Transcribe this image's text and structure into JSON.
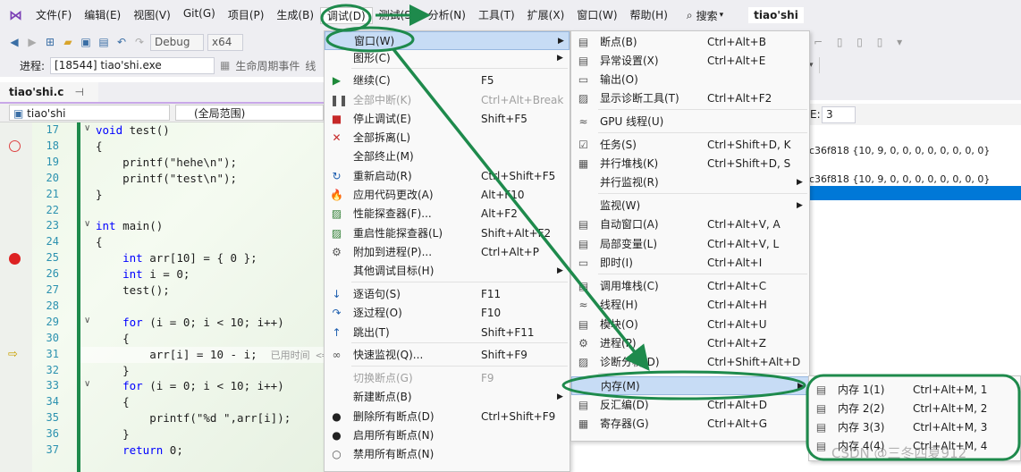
{
  "menubar": {
    "items": [
      "文件(F)",
      "编辑(E)",
      "视图(V)",
      "Git(G)",
      "项目(P)",
      "生成(B)",
      "调试(D)",
      "测试(S)",
      "分析(N)",
      "工具(T)",
      "扩展(X)",
      "窗口(W)",
      "帮助(H)"
    ],
    "search": "搜索",
    "solution": "tiao'shi"
  },
  "toolbar": {
    "config": "Debug",
    "platform": "x64"
  },
  "toolbar2": {
    "process_label": "进程:",
    "process_value": "[18544] tiao'shi.exe",
    "lifecycle": "生命周期事件",
    "thread_prefix": "线"
  },
  "editor": {
    "tab": "tiao'shi.c",
    "tab_pin": "⊣",
    "tab_close": "✕",
    "nav_left": "tiao'shi",
    "nav_right": "(全局范围)",
    "lines": [
      "17",
      "18",
      "19",
      "20",
      "21",
      "22",
      "23",
      "24",
      "25",
      "26",
      "27",
      "28",
      "29",
      "30",
      "31",
      "32",
      "33",
      "34",
      "35",
      "36",
      "37"
    ],
    "code": [
      "void test()",
      "{",
      "    printf(\"hehe\\n\");",
      "    printf(\"test\\n\");",
      "}",
      "",
      "int main()",
      "{",
      "    int arr[10] = { 0 };",
      "    int i = 0;",
      "    test();",
      "",
      "    for (i = 0; i < 10; i++)",
      "    {",
      "        arr[i] = 10 - i;  已用时间 <=",
      "    }",
      "    for (i = 0; i < 10; i++)",
      "    {",
      "        printf(\"%d \",arr[i]);",
      "    }",
      "    return 0;"
    ]
  },
  "debug_menu": {
    "items": [
      {
        "label": "窗口(W)",
        "shortcut": "",
        "icon": "",
        "dis": false,
        "arrow": true
      },
      {
        "label": "图形(C)",
        "shortcut": "",
        "icon": "",
        "dis": false,
        "arrow": true
      },
      {
        "label": "继续(C)",
        "shortcut": "F5",
        "icon": "play-icon",
        "dis": false
      },
      {
        "label": "全部中断(K)",
        "shortcut": "Ctrl+Alt+Break",
        "icon": "pause-icon",
        "dis": true
      },
      {
        "label": "停止调试(E)",
        "shortcut": "Shift+F5",
        "icon": "stop-icon",
        "dis": false
      },
      {
        "label": "全部拆离(L)",
        "shortcut": "",
        "icon": "detach-icon",
        "dis": false
      },
      {
        "label": "全部终止(M)",
        "shortcut": "",
        "icon": "",
        "dis": false
      },
      {
        "label": "重新启动(R)",
        "shortcut": "Ctrl+Shift+F5",
        "icon": "restart-icon",
        "dis": false
      },
      {
        "label": "应用代码更改(A)",
        "shortcut": "Alt+F10",
        "icon": "hot-reload-icon",
        "dis": false
      },
      {
        "label": "性能探查器(F)...",
        "shortcut": "Alt+F2",
        "icon": "profiler-icon",
        "dis": false
      },
      {
        "label": "重启性能探查器(L)",
        "shortcut": "Shift+Alt+F2",
        "icon": "profiler-restart-icon",
        "dis": false
      },
      {
        "label": "附加到进程(P)...",
        "shortcut": "Ctrl+Alt+P",
        "icon": "attach-icon",
        "dis": false
      },
      {
        "label": "其他调试目标(H)",
        "shortcut": "",
        "icon": "",
        "dis": false,
        "arrow": true
      },
      {
        "label": "逐语句(S)",
        "shortcut": "F11",
        "icon": "step-into-icon",
        "dis": false
      },
      {
        "label": "逐过程(O)",
        "shortcut": "F10",
        "icon": "step-over-icon",
        "dis": false
      },
      {
        "label": "跳出(T)",
        "shortcut": "Shift+F11",
        "icon": "step-out-icon",
        "dis": false
      },
      {
        "label": "快速监视(Q)...",
        "shortcut": "Shift+F9",
        "icon": "glasses-icon",
        "dis": false
      },
      {
        "label": "切换断点(G)",
        "shortcut": "F9",
        "icon": "",
        "dis": true
      },
      {
        "label": "新建断点(B)",
        "shortcut": "",
        "icon": "",
        "dis": false,
        "arrow": true
      },
      {
        "label": "删除所有断点(D)",
        "shortcut": "Ctrl+Shift+F9",
        "icon": "delete-breakpoints-icon",
        "dis": false
      },
      {
        "label": "启用所有断点(N)",
        "shortcut": "",
        "icon": "enable-breakpoints-icon",
        "dis": false
      },
      {
        "label": "禁用所有断点(N)",
        "shortcut": "",
        "icon": "disable-breakpoints-icon",
        "dis": false
      }
    ]
  },
  "window_menu": {
    "items": [
      {
        "label": "断点(B)",
        "shortcut": "Ctrl+Alt+B",
        "icon": "breakpoints-window-icon"
      },
      {
        "label": "异常设置(X)",
        "shortcut": "Ctrl+Alt+E",
        "icon": "exception-icon"
      },
      {
        "label": "输出(O)",
        "shortcut": "",
        "icon": "output-icon"
      },
      {
        "label": "显示诊断工具(T)",
        "shortcut": "Ctrl+Alt+F2",
        "icon": "diagnostics-icon"
      },
      {
        "label": "GPU 线程(U)",
        "shortcut": "",
        "icon": "gpu-threads-icon"
      },
      {
        "label": "任务(S)",
        "shortcut": "Ctrl+Shift+D, K",
        "icon": "tasks-icon"
      },
      {
        "label": "并行堆栈(K)",
        "shortcut": "Ctrl+Shift+D, S",
        "icon": "parallel-stacks-icon"
      },
      {
        "label": "并行监视(R)",
        "shortcut": "",
        "icon": "",
        "arrow": true
      },
      {
        "label": "监视(W)",
        "shortcut": "",
        "icon": "",
        "arrow": true
      },
      {
        "label": "自动窗口(A)",
        "shortcut": "Ctrl+Alt+V, A",
        "icon": "autos-icon"
      },
      {
        "label": "局部变量(L)",
        "shortcut": "Ctrl+Alt+V, L",
        "icon": "locals-icon"
      },
      {
        "label": "即时(I)",
        "shortcut": "Ctrl+Alt+I",
        "icon": "immediate-icon"
      },
      {
        "label": "调用堆栈(C)",
        "shortcut": "Ctrl+Alt+C",
        "icon": "call-stack-icon"
      },
      {
        "label": "线程(H)",
        "shortcut": "Ctrl+Alt+H",
        "icon": "threads-icon"
      },
      {
        "label": "模块(O)",
        "shortcut": "Ctrl+Alt+U",
        "icon": "modules-icon"
      },
      {
        "label": "进程(P)",
        "shortcut": "Ctrl+Alt+Z",
        "icon": "processes-icon"
      },
      {
        "label": "诊断分析(D)",
        "shortcut": "Ctrl+Shift+Alt+D",
        "icon": "diagnostic-analysis-icon"
      },
      {
        "label": "内存(M)",
        "shortcut": "",
        "icon": "",
        "arrow": true
      },
      {
        "label": "反汇编(D)",
        "shortcut": "Ctrl+Alt+D",
        "icon": "disassembly-icon"
      },
      {
        "label": "寄存器(G)",
        "shortcut": "Ctrl+Alt+G",
        "icon": "registers-icon"
      }
    ]
  },
  "memory_menu": {
    "items": [
      {
        "label": "内存 1(1)",
        "shortcut": "Ctrl+Alt+M, 1"
      },
      {
        "label": "内存 2(2)",
        "shortcut": "Ctrl+Alt+M, 2"
      },
      {
        "label": "内存 3(3)",
        "shortcut": "Ctrl+Alt+M, 3"
      },
      {
        "label": "内存 4(4)",
        "shortcut": "Ctrl+Alt+M, 4"
      }
    ]
  },
  "right_panel": {
    "depth_label": "E:",
    "depth_value": "3",
    "values": [
      "c36f818 {10, 9, 0, 0, 0, 0, 0, 0, 0, 0}",
      "c36f818 {10, 9, 0, 0, 0, 0, 0, 0, 0, 0}"
    ]
  },
  "watermark": "CSDN @三冬四夏912",
  "colors": {
    "accent_green": "#1e8a4c",
    "highlight": "#c7dcf5"
  }
}
